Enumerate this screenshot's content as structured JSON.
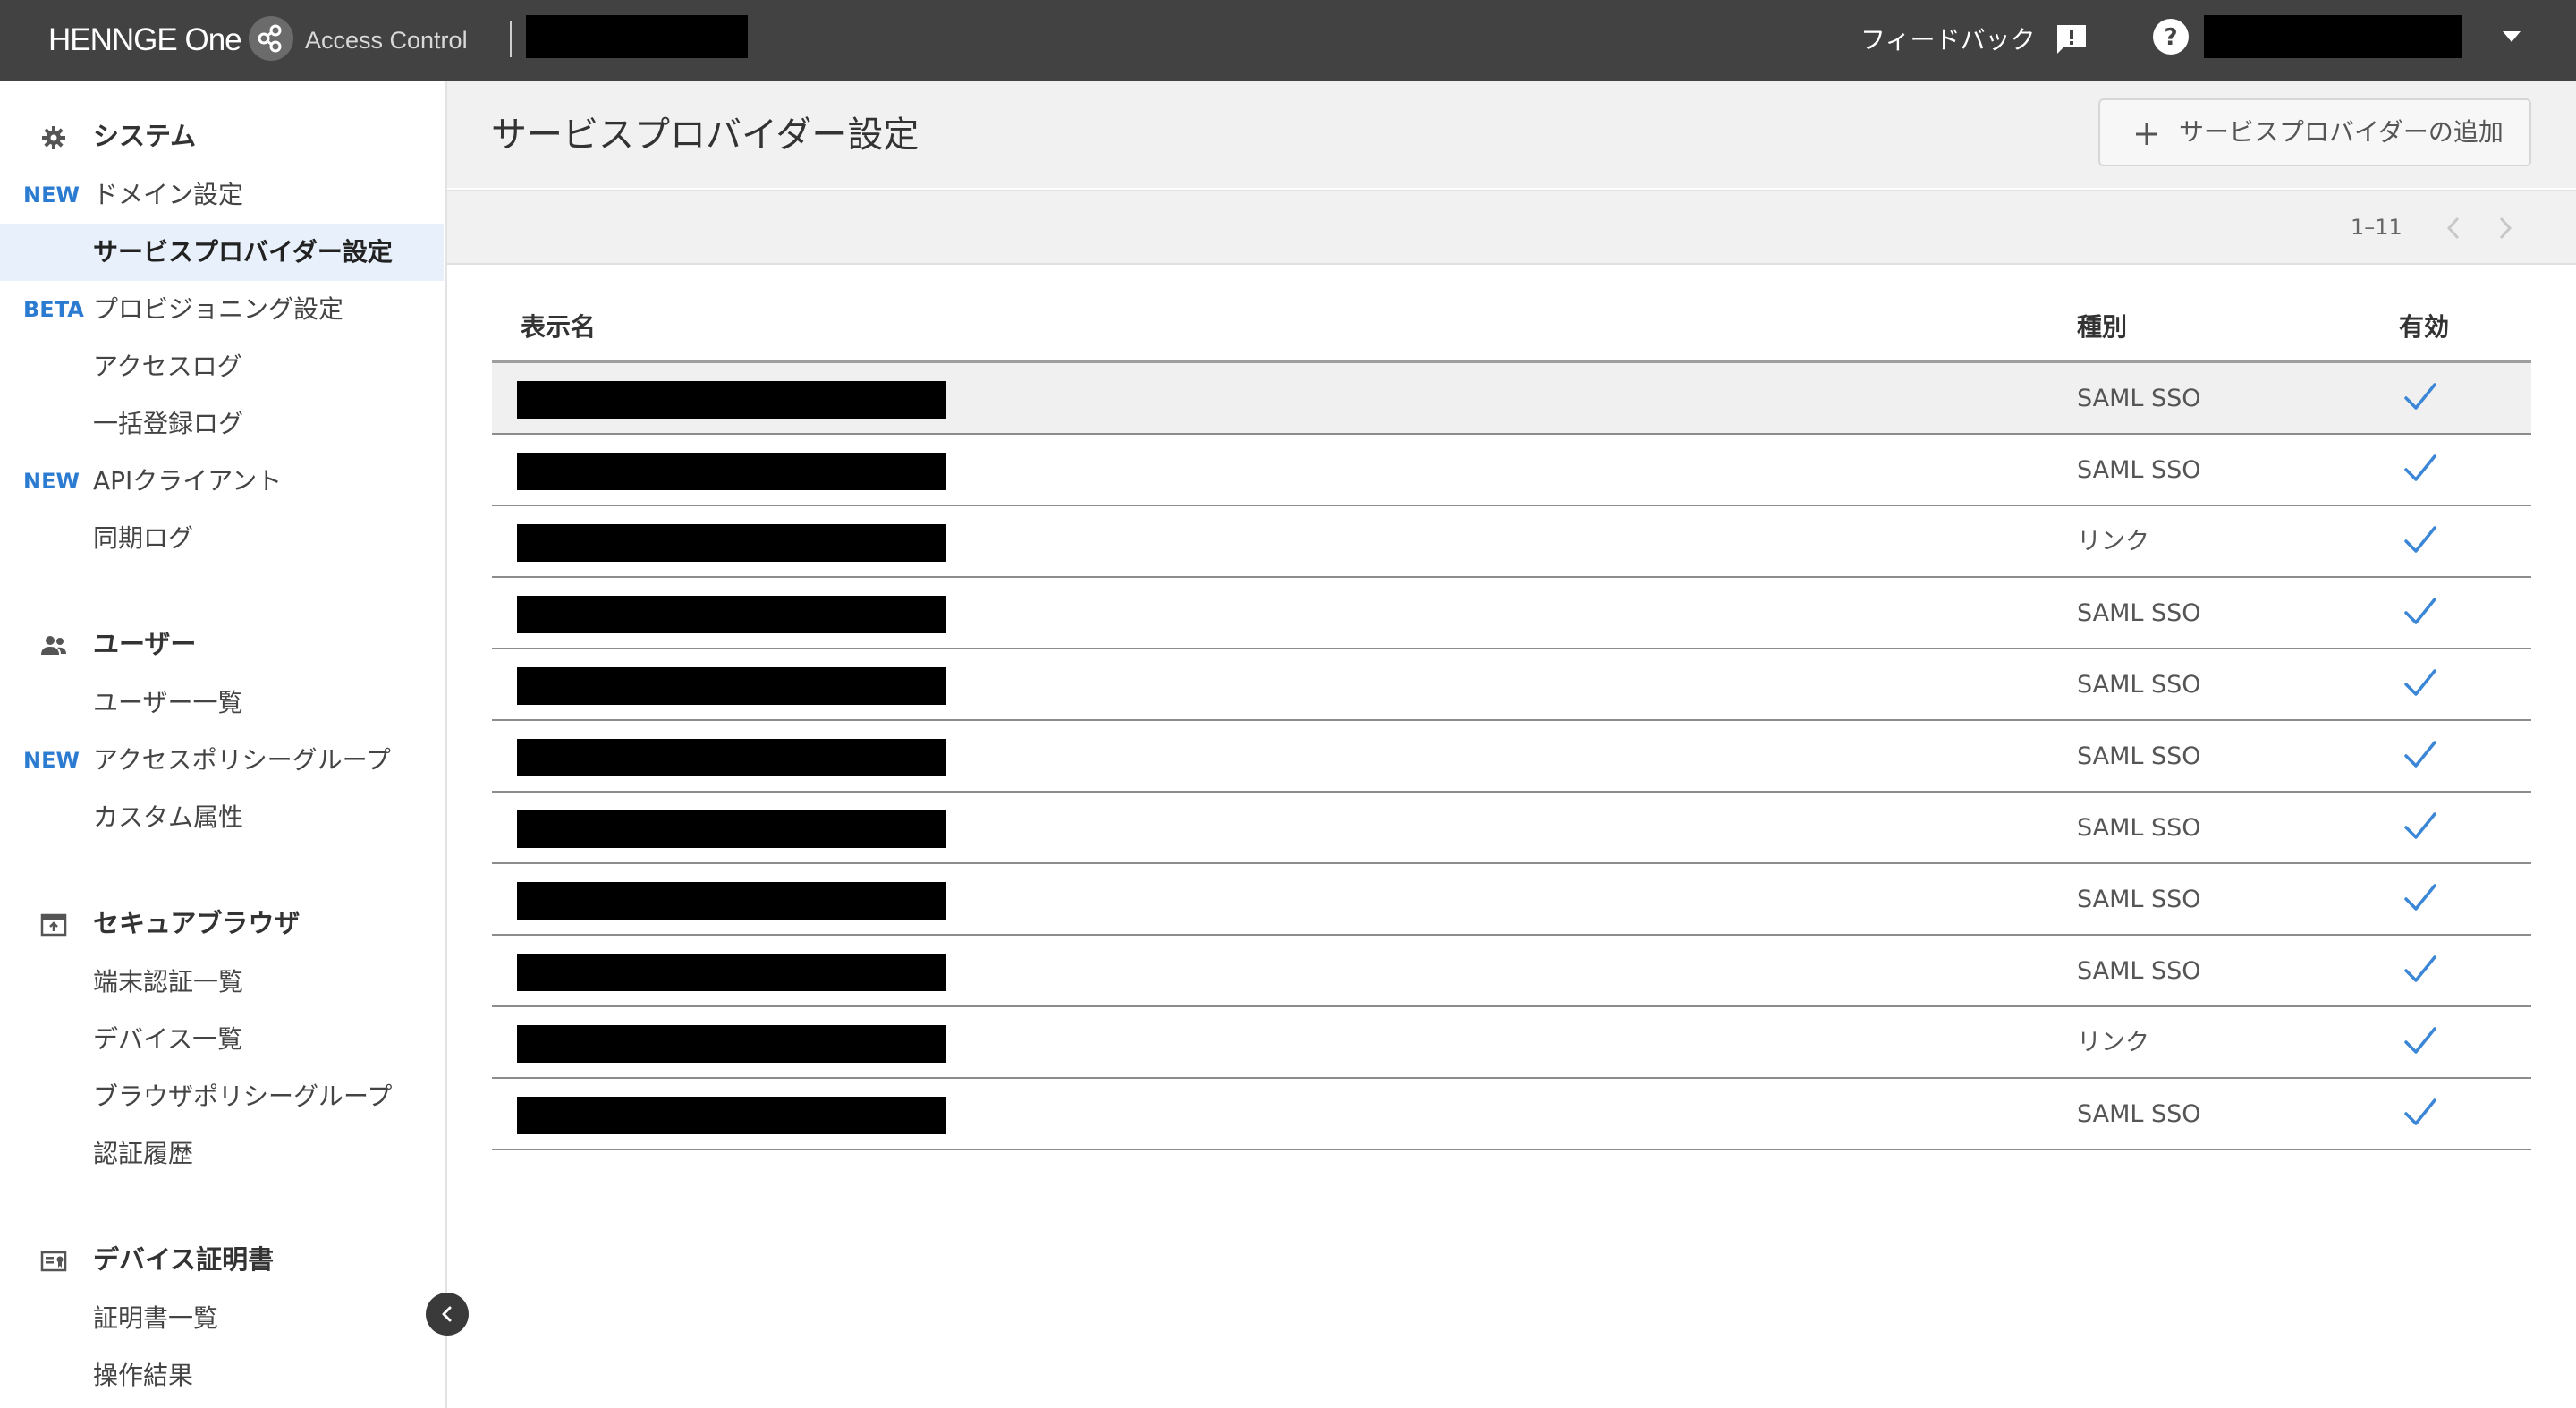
{
  "topbar": {
    "brand": "HENNGE One",
    "product": "Access Control",
    "feedback_label": "フィードバック"
  },
  "sidebar": {
    "sections": [
      {
        "title": "システム",
        "icon": "gear-icon",
        "items": [
          {
            "tag": "NEW",
            "label": "ドメイン設定"
          },
          {
            "tag": "",
            "label": "サービスプロバイダー設定",
            "active": true
          },
          {
            "tag": "BETA",
            "label": "プロビジョニング設定"
          },
          {
            "tag": "",
            "label": "アクセスログ"
          },
          {
            "tag": "",
            "label": "一括登録ログ"
          },
          {
            "tag": "NEW",
            "label": "APIクライアント"
          },
          {
            "tag": "",
            "label": "同期ログ"
          }
        ]
      },
      {
        "title": "ユーザー",
        "icon": "users-icon",
        "items": [
          {
            "tag": "",
            "label": "ユーザー一覧"
          },
          {
            "tag": "NEW",
            "label": "アクセスポリシーグループ"
          },
          {
            "tag": "",
            "label": "カスタム属性"
          }
        ]
      },
      {
        "title": "セキュアブラウザ",
        "icon": "browser-icon",
        "items": [
          {
            "tag": "",
            "label": "端末認証一覧"
          },
          {
            "tag": "",
            "label": "デバイス一覧"
          },
          {
            "tag": "",
            "label": "ブラウザポリシーグループ"
          },
          {
            "tag": "",
            "label": "認証履歴"
          }
        ]
      },
      {
        "title": "デバイス証明書",
        "icon": "certificate-icon",
        "items": [
          {
            "tag": "",
            "label": "証明書一覧"
          },
          {
            "tag": "",
            "label": "操作結果"
          }
        ]
      }
    ]
  },
  "main": {
    "title": "サービスプロバイダー設定",
    "add_button_label": "サービスプロバイダーの追加",
    "pagination": "1–11"
  },
  "table": {
    "headers": {
      "name": "表示名",
      "type": "種別",
      "enabled": "有効"
    },
    "rows": [
      {
        "type": "SAML SSO",
        "enabled": true
      },
      {
        "type": "SAML SSO",
        "enabled": true
      },
      {
        "type": "リンク",
        "enabled": true
      },
      {
        "type": "SAML SSO",
        "enabled": true
      },
      {
        "type": "SAML SSO",
        "enabled": true
      },
      {
        "type": "SAML SSO",
        "enabled": true
      },
      {
        "type": "SAML SSO",
        "enabled": true
      },
      {
        "type": "SAML SSO",
        "enabled": true
      },
      {
        "type": "SAML SSO",
        "enabled": true
      },
      {
        "type": "リンク",
        "enabled": true
      },
      {
        "type": "SAML SSO",
        "enabled": true
      }
    ]
  },
  "colors": {
    "topbar": "#424242",
    "accent": "#2b7bd1",
    "active_nav": "#e8f1fb",
    "check": "#3b86d6"
  }
}
